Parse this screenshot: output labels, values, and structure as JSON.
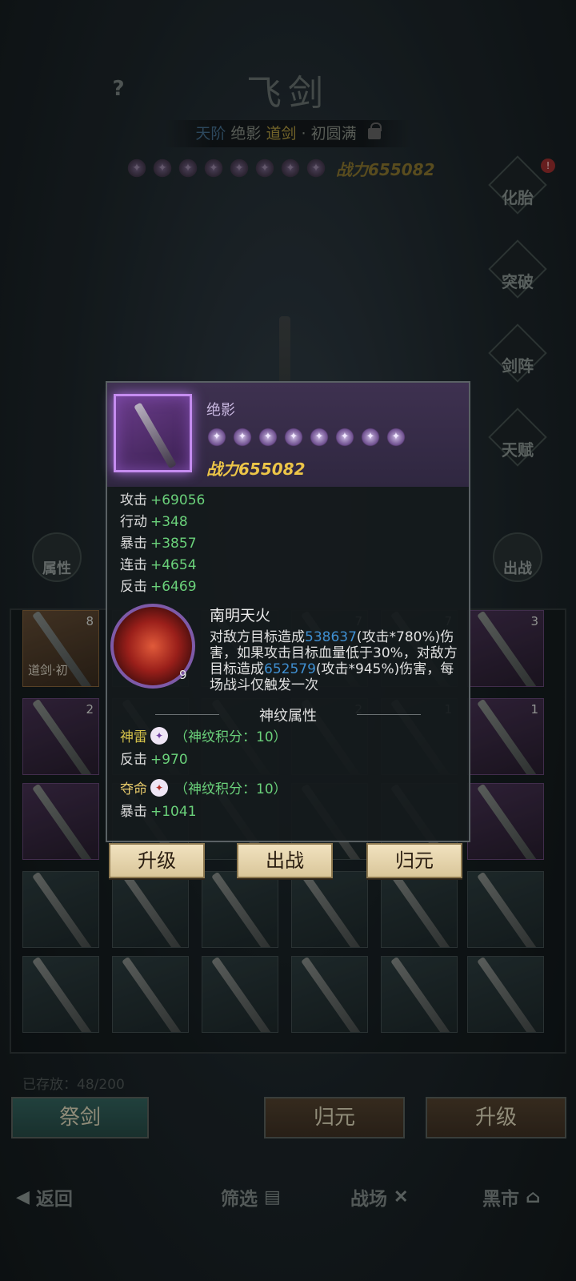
{
  "header": {
    "title": "飞剑",
    "help_label": "?",
    "subtitle": {
      "grade": "天阶",
      "name": "绝影",
      "type": "道剑",
      "separator": "·",
      "stage": "初圆满"
    },
    "power_label": "战力655082",
    "star_count": 8
  },
  "side_buttons": [
    {
      "label": "化胎",
      "badge": "!"
    },
    {
      "label": "突破"
    },
    {
      "label": "剑阵"
    },
    {
      "label": "天赋"
    }
  ],
  "left_button": {
    "label": "属性"
  },
  "right_button": {
    "label": "出战"
  },
  "inventory": {
    "slots": [
      {
        "level": "8",
        "tag": "道剑·初",
        "rarity": "gold"
      },
      {
        "level": "",
        "rarity": "teal"
      },
      {
        "level": "",
        "rarity": "teal"
      },
      {
        "level": "7",
        "rarity": "teal"
      },
      {
        "level": "7",
        "rarity": "teal"
      },
      {
        "level": "3",
        "rarity": "purple"
      },
      {
        "level": "2",
        "rarity": "purple"
      },
      {
        "level": "",
        "rarity": "teal"
      },
      {
        "level": "",
        "rarity": "teal"
      },
      {
        "level": "2",
        "rarity": "teal"
      },
      {
        "level": "1",
        "rarity": "teal"
      },
      {
        "level": "1",
        "rarity": "purple"
      },
      {
        "level": "",
        "rarity": "purple"
      },
      {
        "level": "",
        "rarity": "teal"
      },
      {
        "level": "",
        "rarity": "teal"
      },
      {
        "level": "",
        "rarity": "teal"
      },
      {
        "level": "",
        "rarity": "teal"
      },
      {
        "level": "",
        "rarity": "purple"
      },
      {
        "level": "",
        "rarity": "teal"
      },
      {
        "level": "",
        "rarity": "teal"
      },
      {
        "level": "",
        "rarity": "teal"
      },
      {
        "level": "",
        "rarity": "teal"
      },
      {
        "level": "",
        "rarity": "teal"
      },
      {
        "level": "",
        "rarity": "teal"
      },
      {
        "level": "",
        "rarity": "teal"
      },
      {
        "level": "",
        "rarity": "teal"
      },
      {
        "level": "",
        "rarity": "teal"
      },
      {
        "level": "",
        "rarity": "teal"
      },
      {
        "level": "",
        "rarity": "teal"
      },
      {
        "level": "",
        "rarity": "teal"
      }
    ]
  },
  "storage": {
    "label": "已存放：48/200"
  },
  "footer_buttons": {
    "sacrifice": "祭剑",
    "return": "归元",
    "upgrade": "升级"
  },
  "bottom_nav": {
    "back": "返回",
    "filter": "筛选",
    "battlefield": "战场",
    "black_market": "黑市"
  },
  "popup": {
    "name": "绝影",
    "star_count": 8,
    "power_label": "战力655082",
    "stats": [
      {
        "name": "攻击",
        "value": "+69056"
      },
      {
        "name": "行动",
        "value": "+348"
      },
      {
        "name": "暴击",
        "value": "+3857"
      },
      {
        "name": "连击",
        "value": "+4654"
      },
      {
        "name": "反击",
        "value": "+6469"
      }
    ],
    "skill": {
      "name": "南明天火",
      "level": "9",
      "desc_1": "对敌方目标造成",
      "dmg_1": "538637",
      "desc_2": "(攻击*780%)伤害，如果攻击目标血量低于30%，对敌方目标造成",
      "dmg_2": "652579",
      "desc_3": "(攻击*945%)伤害，每场战斗仅触发一次"
    },
    "rune_section_title": "神纹属性",
    "runes": [
      {
        "name": "神雷",
        "score": "（神纹积分：10）",
        "stat_name": "反击",
        "stat_value": "+970"
      },
      {
        "name": "夺命",
        "score": "（神纹积分：10）",
        "stat_name": "暴击",
        "stat_value": "+1041"
      }
    ],
    "actions": {
      "upgrade": "升级",
      "deploy": "出战",
      "return": "归元"
    }
  }
}
